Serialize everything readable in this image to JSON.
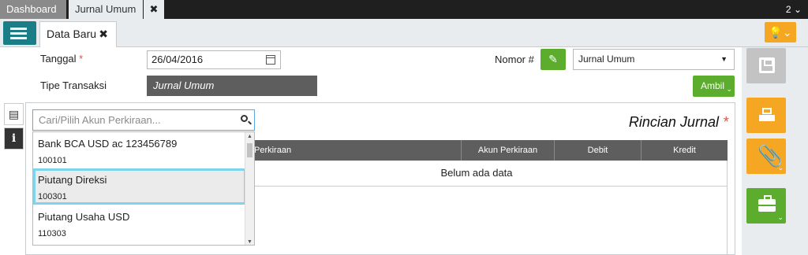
{
  "top_tabs": {
    "dashboard": "Dashboard",
    "jurnal_umum": "Jurnal Umum",
    "close": "✖",
    "count": "2"
  },
  "sub_tab": {
    "label": "Data Baru",
    "close": "✖"
  },
  "form": {
    "tanggal_label": "Tanggal",
    "required_mark": "*",
    "tanggal_value": "26/04/2016",
    "tipe_label": "Tipe Transaksi",
    "tipe_value": "Jurnal Umum",
    "nomor_label": "Nomor #",
    "nomor_select": "Jurnal Umum",
    "ambil_label": "Ambil"
  },
  "search": {
    "placeholder": "Cari/Pilih Akun Perkiraan..."
  },
  "dropdown": {
    "items": [
      {
        "name": "Bank BCA USD ac 123456789",
        "code": "100101"
      },
      {
        "name": "Piutang Direksi",
        "code": "100301",
        "selected": true
      },
      {
        "name": "Piutang Usaha USD",
        "code": "110303"
      }
    ]
  },
  "panel": {
    "title": "Rincian Jurnal",
    "columns": [
      "Perkiraan",
      "Akun Perkiraan",
      "Debit",
      "Kredit"
    ],
    "empty_text": "Belum ada data"
  },
  "colors": {
    "teal": "#1b7d85",
    "green": "#5cad2e",
    "orange": "#f5a623",
    "dark": "#1f1f1f",
    "highlight": "#7fd3ea"
  },
  "icons": [
    "menu-list-icon",
    "lightbulb-icon",
    "calendar-icon",
    "pencil-icon",
    "search-icon",
    "save-icon",
    "print-icon",
    "paperclip-icon",
    "briefcase-icon",
    "document-icon",
    "info-icon"
  ]
}
